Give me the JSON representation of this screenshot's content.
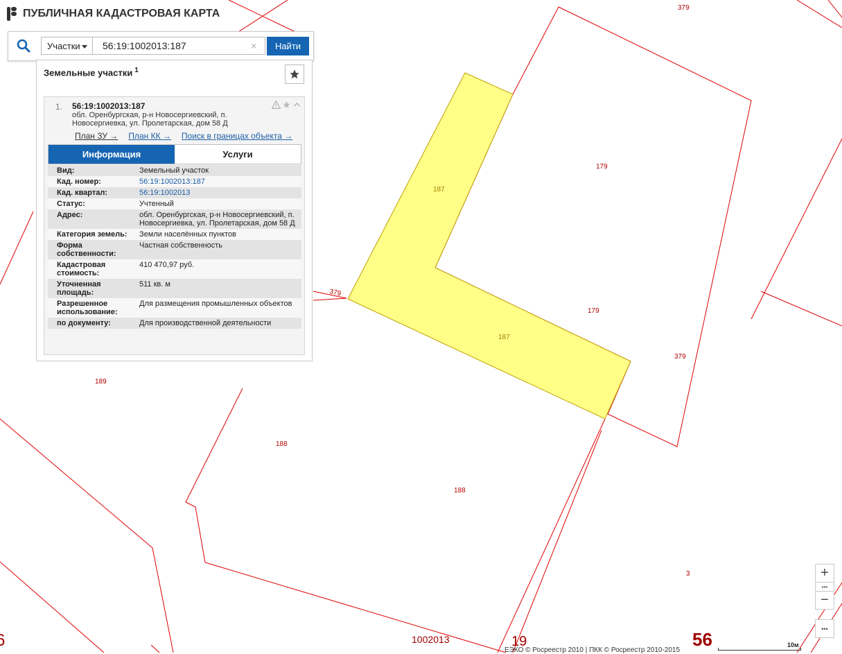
{
  "header": {
    "title": "ПУБЛИЧНАЯ КАДАСТРОВАЯ КАРТА"
  },
  "search": {
    "type_label": "Участки",
    "query": "56:19:1002013:187",
    "clear": "×",
    "find_label": "Найти"
  },
  "panel": {
    "title": "Земельные участки",
    "count": "1",
    "result": {
      "index": "1.",
      "cad_number": "56:19:1002013:187",
      "address": "обл. Оренбургская, р-н Новосергиевский, п. Новосергиевка, ул. Пролетарская, дом 58 Д",
      "links": [
        "План ЗУ →",
        "План КК →",
        "Поиск в границах объекта →"
      ],
      "tabs": [
        "Информация",
        "Услуги"
      ],
      "info": [
        {
          "k": "Вид:",
          "v": "Земельный участок"
        },
        {
          "k": "Кад. номер:",
          "v": "56:19:1002013:187"
        },
        {
          "k": "Кад. квартал:",
          "v": "56:19:1002013"
        },
        {
          "k": "Статус:",
          "v": "Учтенный"
        },
        {
          "k": "Адрес:",
          "v": "обл. Оренбургская, р-н Новосергиевский, п. Новосергиевка, ул. Пролетарская, дом 58 Д"
        },
        {
          "k": "Категория земель:",
          "v": "Земли населённых пунктов"
        },
        {
          "k": "Форма собственности:",
          "v": "Частная собственность"
        },
        {
          "k": "Кадастровая стоимость:",
          "v": "410 470,97 руб."
        },
        {
          "k": "Уточненная площадь:",
          "v": "511 кв. м"
        },
        {
          "k": "Разрешенное использование:",
          "v": "Для размещения промышленных объектов"
        },
        {
          "k": "по документу:",
          "v": "Для производственной деятельности"
        }
      ]
    }
  },
  "map": {
    "parcel_labels": {
      "l379_top": "379",
      "l179_a": "179",
      "l179_b": "179",
      "l187_a": "187",
      "l187_b": "187",
      "l379_left": "379",
      "l379_right": "379",
      "l189": "189",
      "l188_a": "188",
      "l188_b": "188",
      "l3": "3"
    },
    "bottom_labels": {
      "quarter": "1002013",
      "district": "19",
      "region": "56",
      "region_left": "6"
    },
    "colors": {
      "boundary": "#e00000",
      "selected_fill": "#ffff88",
      "selected_stroke": "#c0a000"
    }
  },
  "controls": {
    "zoom_in": "+",
    "zoom_out": "−",
    "more": "•••"
  },
  "footer": {
    "credits": "ЕЭКО © Росреестр 2010 | ПКК © Росреестр 2010-2015",
    "scale": "10м"
  }
}
